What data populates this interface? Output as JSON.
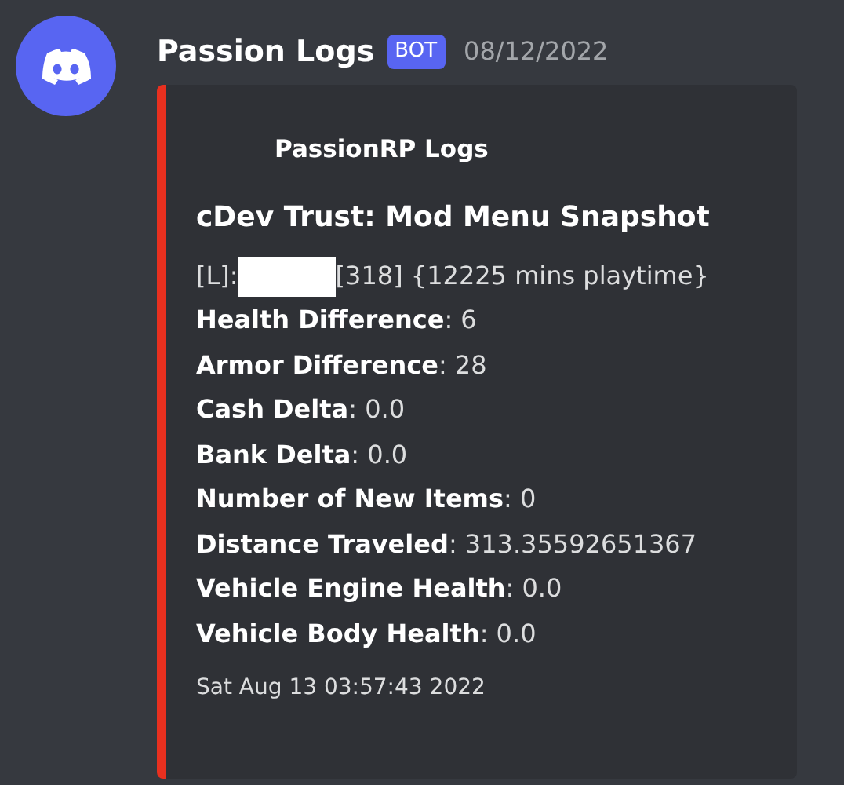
{
  "message": {
    "author": "Passion Logs",
    "badge": "BOT",
    "timestamp": "08/12/2022"
  },
  "embed": {
    "color": "#e8301f",
    "author": "PassionRP Logs",
    "title": "cDev Trust: Mod Menu Snapshot",
    "description": {
      "before": "[L]:",
      "after": "[318] {12225 mins playtime}"
    },
    "fields": [
      {
        "text": "**Health Difference**: 6"
      },
      {
        "text": "**Armor Difference**: 28"
      },
      {
        "text": "**Cash Delta**: 0.0"
      },
      {
        "text": "**Bank Delta**: 0.0"
      },
      {
        "text": "**Number of New Items**: 0"
      },
      {
        "text": "**Distance Traveled**: 313.35592651367"
      },
      {
        "text": "**Vehicle Engine Health**: 0.0"
      },
      {
        "text": "**Vehicle Body Health**: 0.0"
      }
    ],
    "footer": "Sat Aug 13 03:57:43 2022"
  }
}
